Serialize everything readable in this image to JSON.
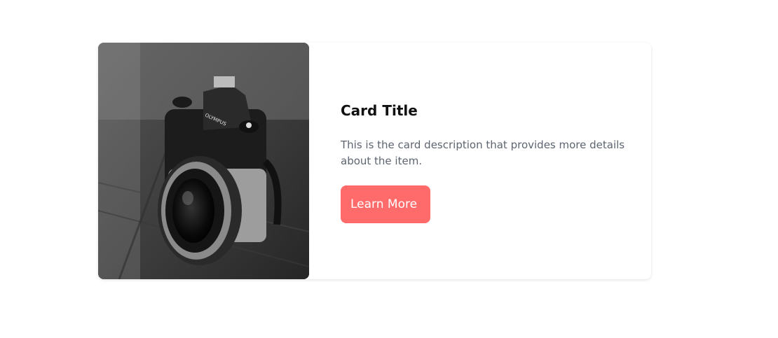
{
  "card": {
    "image_alt": "Black and white photo of an Olympus camera on a wooden table",
    "camera_brand": "OLYMPUS",
    "title": "Card Title",
    "description": "This is the card description that provides more details about the item.",
    "button_label": "Learn More"
  },
  "colors": {
    "button_bg": "#ff6b6b",
    "title": "#111111",
    "description": "#5d6570",
    "card_bg": "#ffffff"
  }
}
